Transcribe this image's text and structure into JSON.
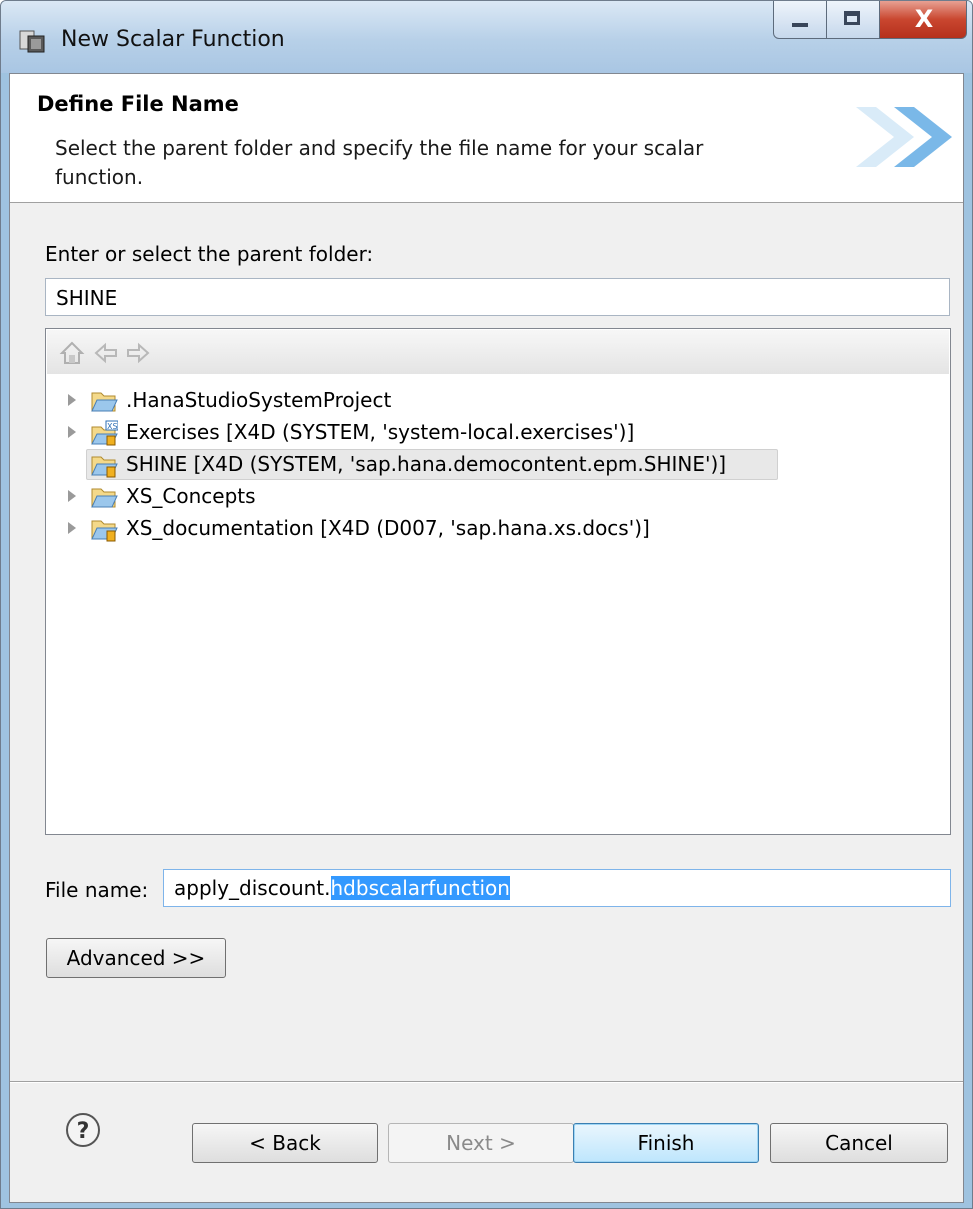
{
  "window": {
    "title": "New Scalar Function",
    "close_glyph": "X"
  },
  "header": {
    "title": "Define File Name",
    "description": "Select the parent folder and specify the file name for your scalar function."
  },
  "parent_folder": {
    "label": "Enter or select the parent folder:",
    "value": "SHINE"
  },
  "tree": {
    "items": [
      {
        "label": ".HanaStudioSystemProject",
        "icon": "open-folder-icon",
        "expandable": true,
        "selected": false
      },
      {
        "label": "Exercises [X4D (SYSTEM, 'system-local.exercises')]",
        "icon": "xs-project-folder-icon",
        "expandable": true,
        "selected": false
      },
      {
        "label": "SHINE [X4D (SYSTEM, 'sap.hana.democontent.epm.SHINE')]",
        "icon": "shared-project-folder-icon",
        "expandable": false,
        "selected": true
      },
      {
        "label": "XS_Concepts",
        "icon": "open-folder-icon",
        "expandable": true,
        "selected": false
      },
      {
        "label": "XS_documentation [X4D (D007, 'sap.hana.xs.docs')]",
        "icon": "shared-project-folder-icon",
        "expandable": true,
        "selected": false
      }
    ]
  },
  "file_name": {
    "label": "File name:",
    "value_prefix": "apply_discount.",
    "value_selected": "hdbscalarfunction"
  },
  "buttons": {
    "advanced": "Advanced >>",
    "back": "< Back",
    "next": "Next >",
    "finish": "Finish",
    "cancel": "Cancel"
  },
  "help_glyph": "?",
  "colors": {
    "selection": "#3399ff",
    "finish_default_border": "#3c7fb1",
    "close_button": "#c9462f"
  }
}
